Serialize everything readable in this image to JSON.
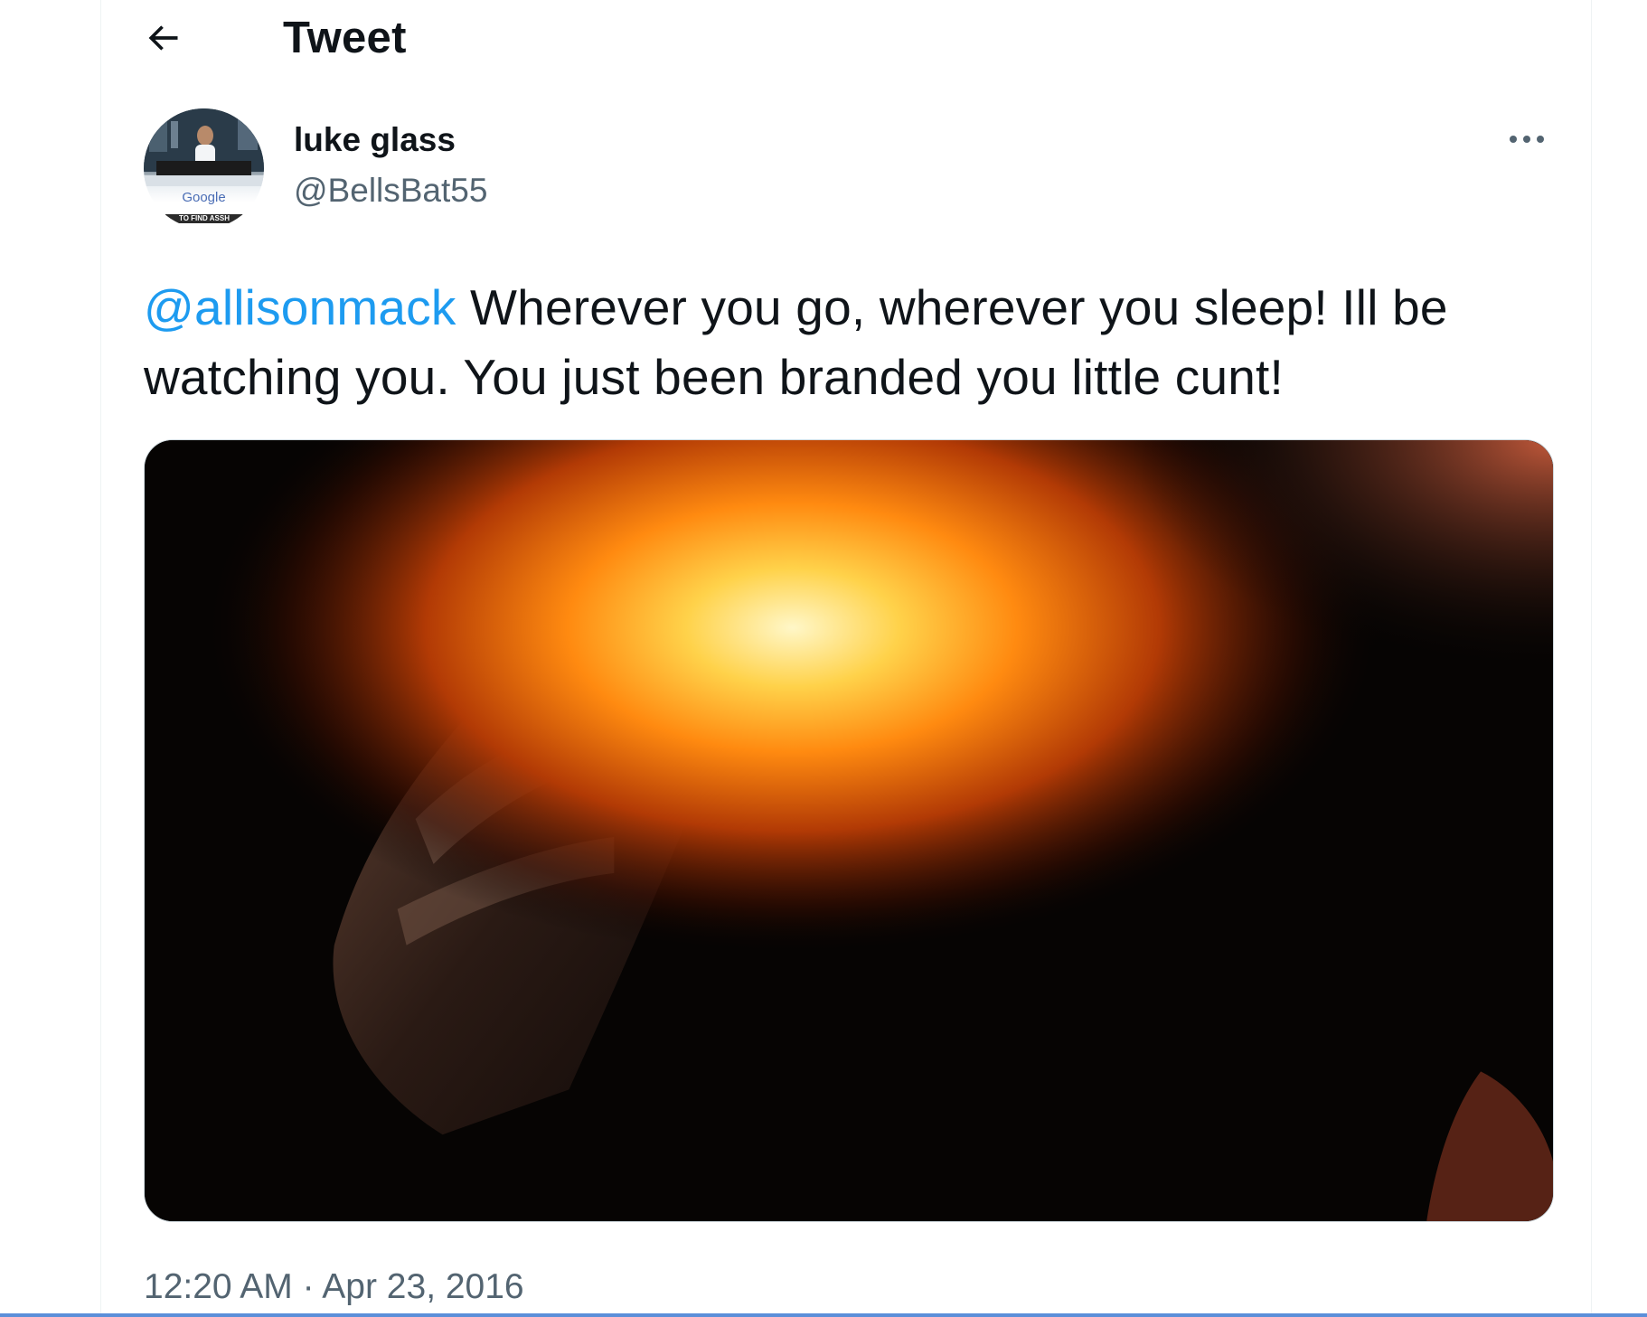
{
  "header": {
    "back_icon": "arrow-left-icon",
    "title": "Tweet"
  },
  "author": {
    "display_name": "luke glass",
    "handle": "@BellsBat55",
    "avatar_logo_text": "Google",
    "avatar_band_text": "TO FIND ASSH"
  },
  "tweet": {
    "mention": "@allisonmack",
    "text": " Wherever you go, wherever you sleep! Ill be watching you. You just been branded you little cunt!",
    "media_description_icon": "image-icon",
    "timestamp": "12:20 AM · Apr 23, 2016"
  },
  "menu": {
    "more_icon": "more-icon"
  },
  "colors": {
    "accent": "#1d9bf0",
    "secondary_text": "#536471",
    "text": "#0f1419"
  }
}
